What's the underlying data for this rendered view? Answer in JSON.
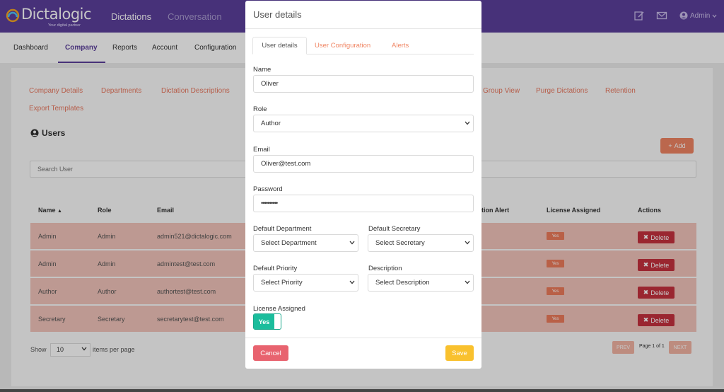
{
  "header": {
    "logo_text": "Dictalogic",
    "logo_tagline": "Your digital partner",
    "nav": [
      "Dictations",
      "Conversation"
    ],
    "user_label": "Admin"
  },
  "subnav": {
    "items": [
      "Dashboard",
      "Company",
      "Reports",
      "Account",
      "Configuration"
    ],
    "active": "Company"
  },
  "company_links": {
    "left": [
      "Company Details",
      "Departments",
      "Dictation Descriptions"
    ],
    "right": [
      "Group View",
      "Purge Dictations",
      "Retention"
    ],
    "second_row": [
      "Export Templates"
    ]
  },
  "users": {
    "title": "Users",
    "add_label": "Add",
    "search_placeholder": "Search User",
    "columns": [
      "Name",
      "Role",
      "Email",
      "tion Alert",
      "License Assigned",
      "Actions"
    ],
    "rows": [
      {
        "name": "Admin",
        "role": "Admin",
        "email": "admin521@dictalogic.com",
        "license": "Yes",
        "action": "Delete"
      },
      {
        "name": "Admin",
        "role": "Admin",
        "email": "admintest@test.com",
        "license": "Yes",
        "action": "Delete"
      },
      {
        "name": "Author",
        "role": "Author",
        "email": "authortest@test.com",
        "license": "Yes",
        "action": "Delete"
      },
      {
        "name": "Secretary",
        "role": "Secretary",
        "email": "secretarytest@test.com",
        "license": "Yes",
        "action": "Delete"
      }
    ],
    "show_label": "Show",
    "per_page_value": "10",
    "per_page_label": "items per page",
    "prev_label": "PREV",
    "page_text": "Page 1 of 1",
    "next_label": "NEXT"
  },
  "modal": {
    "title": "User details",
    "tabs": [
      "User details",
      "User Configuration",
      "Alerts"
    ],
    "active_tab": "User details",
    "fields": {
      "name_label": "Name",
      "name_value": "Oliver",
      "role_label": "Role",
      "role_value": "Author",
      "email_label": "Email",
      "email_value": "Oliver@test.com",
      "password_label": "Password",
      "password_value": "••••••••••",
      "department_label": "Default Department",
      "department_value": "Select Department",
      "secretary_label": "Default Secretary",
      "secretary_value": "Select Secretary",
      "priority_label": "Default Priority",
      "priority_value": "Select Priority",
      "description_label": "Description",
      "description_value": "Select Description",
      "license_label": "License Assigned",
      "license_value": "Yes"
    },
    "cancel_label": "Cancel",
    "save_label": "Save"
  },
  "colors": {
    "brand_purple": "#5b3f9c",
    "accent_orange": "#f08563",
    "delete_red": "#c6313e",
    "toggle_green": "#1bbd9c",
    "save_yellow": "#f9c12e",
    "cancel_pink": "#e8636f"
  },
  "icons": [
    "logo-mark-icon",
    "edit-icon",
    "mail-icon",
    "user-circle-icon",
    "chevron-down-icon",
    "plus-icon",
    "sort-up-icon",
    "times-icon"
  ]
}
